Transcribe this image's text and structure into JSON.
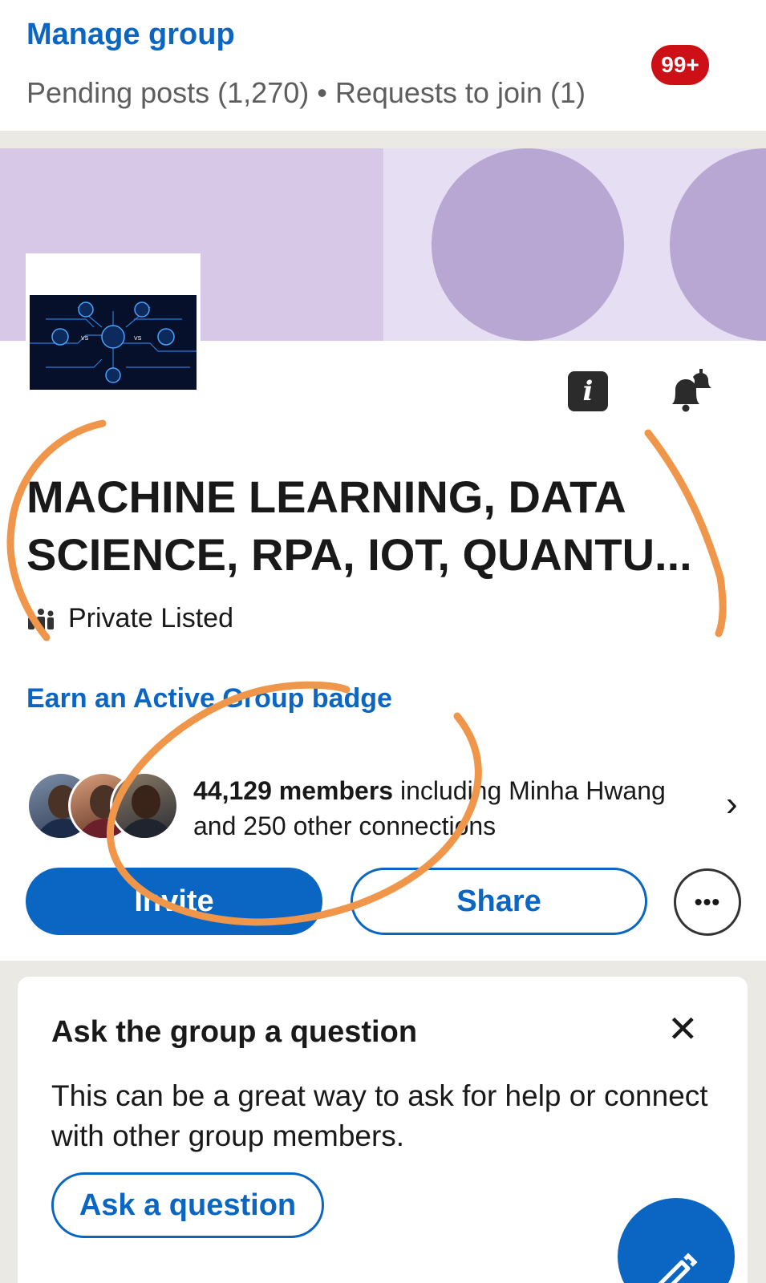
{
  "manage": {
    "title": "Manage group",
    "pending": "Pending posts (1,270) • Requests to join (1)",
    "notification_badge": "99+"
  },
  "cover": {
    "logo_icon": "ai-ml-dl-circuit-logo"
  },
  "actions": {
    "info_icon": "info-icon",
    "bell_icon": "notification-bell-icon"
  },
  "group": {
    "title": "MACHINE LEARNING, DATA SCIENCE, RPA, IOT, QUANTU...",
    "privacy": "Private Listed",
    "earn_badge": "Earn an Active Group badge"
  },
  "members": {
    "count": "44,129 members",
    "connections": " including Minha Hwang and 250 other connections",
    "chevron": "›"
  },
  "buttons": {
    "invite": "Invite",
    "share": "Share",
    "more": "•••"
  },
  "ask_card": {
    "title": "Ask the group a question",
    "close": "✕",
    "body": "This can be a great way to ask for help or connect with other group members.",
    "button": "Ask a question"
  },
  "colors": {
    "brand_blue": "#0a66c2",
    "badge_red": "#cc1016",
    "annotation_orange": "#f0964a"
  }
}
